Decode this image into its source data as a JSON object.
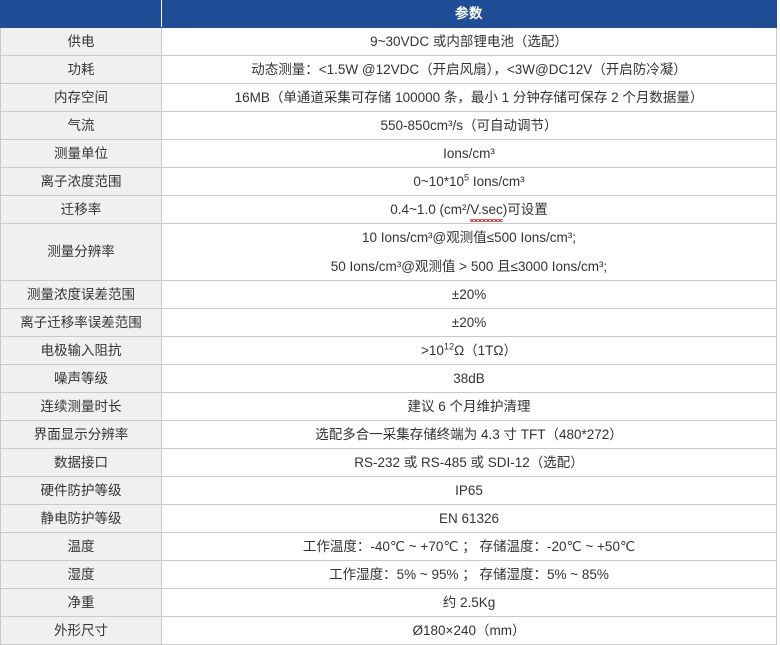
{
  "table": {
    "header": {
      "label_column": "",
      "value_column": "参数"
    },
    "rows": [
      {
        "label": "供电",
        "value": "9~30VDC 或内部锂电池（选配）",
        "tall": false
      },
      {
        "label": "功耗",
        "value": "动态测量：<1.5W @12VDC（开启风扇），<3W@DC12V（开启防冷凝）",
        "tall": false
      },
      {
        "label": "内存空间",
        "value": "16MB（单通道采集可存储 100000 条，最小 1 分钟存储可保存 2 个月数据量）",
        "tall": false
      },
      {
        "label": "气流",
        "value": "550-850cm³/s（可自动调节）",
        "tall": false
      },
      {
        "label": "测量单位",
        "value": "Ions/cm³",
        "tall": false
      },
      {
        "label": "离子浓度范围",
        "value": "0~10*10⁵ Ions/cm³",
        "tall": false
      },
      {
        "label": "迁移率",
        "value": "0.4~1.0 (cm²/V.sec)可设置",
        "tall": false
      },
      {
        "label": "测量分辨率",
        "value": "10 Ions/cm³@观测值≤500 Ions/cm³;",
        "value2": "50 Ions/cm³@观测值 > 500 且≤3000 Ions/cm³;",
        "tall": true
      },
      {
        "label": "测量浓度误差范围",
        "value": "±20%",
        "tall": false
      },
      {
        "label": "离子迁移率误差范围",
        "value": "±20%",
        "tall": false
      },
      {
        "label": "电极输入阻抗",
        "value": ">10¹²Ω（1TΩ）",
        "tall": false
      },
      {
        "label": "噪声等级",
        "value": "38dB",
        "tall": false
      },
      {
        "label": "连续测量时长",
        "value": "建议 6 个月维护清理",
        "tall": false
      },
      {
        "label": "界面显示分辨率",
        "value": "选配多合一采集存储终端为 4.3 寸 TFT（480*272）",
        "tall": false
      },
      {
        "label": "数据接口",
        "value": "RS-232 或 RS-485 或 SDI-12（选配）",
        "tall": false
      },
      {
        "label": "硬件防护等级",
        "value": "IP65",
        "tall": false
      },
      {
        "label": "静电防护等级",
        "value": "EN 61326",
        "tall": false
      },
      {
        "label": "温度",
        "value": "工作温度：-40℃ ~ +70℃ ；  存储温度：-20℃ ~ +50℃",
        "tall": false
      },
      {
        "label": "湿度",
        "value": "工作湿度：5% ~ 95% ；  存储湿度：5% ~ 85%",
        "tall": false
      },
      {
        "label": "净重",
        "value": "约 2.5Kg",
        "tall": false
      },
      {
        "label": "外形尺寸",
        "value": "Ø180×240（mm）",
        "tall": false
      }
    ]
  },
  "colors": {
    "header_blue": "#1f4e96",
    "label_background": "#f0f0f0",
    "border": "#c9c9c9",
    "text": "#333333",
    "spellcheck_red": "#e02b2b"
  }
}
